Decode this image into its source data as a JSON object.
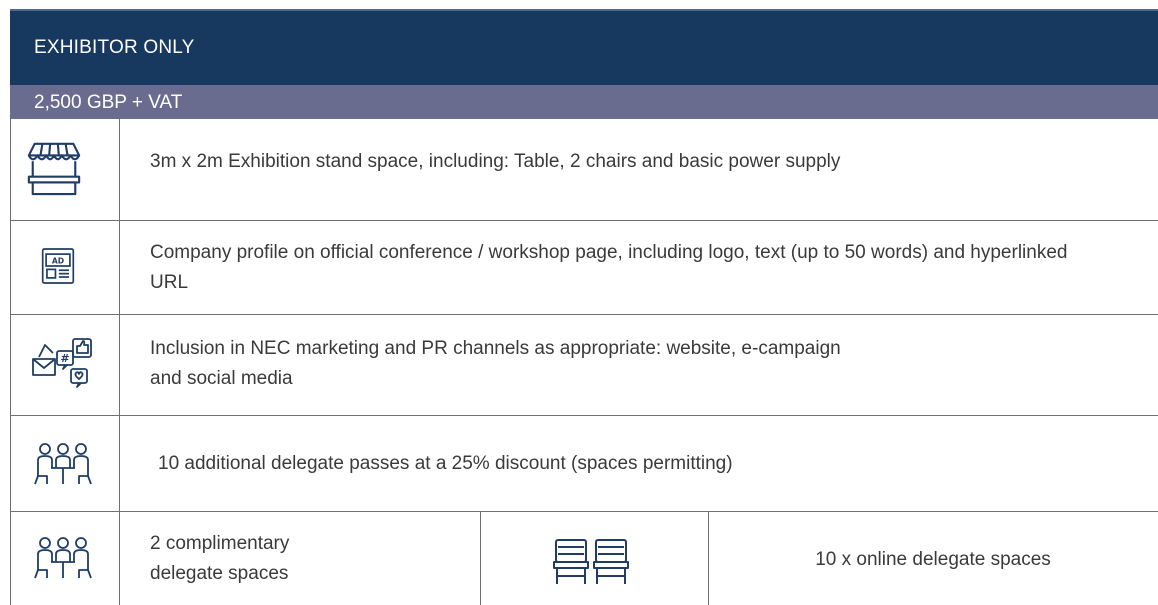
{
  "package": {
    "title": "EXHIBITOR ONLY",
    "price": "2,500 GBP + VAT"
  },
  "benefits": [
    {
      "icon": "market-stall-icon",
      "text": "3m x 2m Exhibition stand space, including: Table, 2 chairs and basic power supply"
    },
    {
      "icon": "ad-newspaper-icon",
      "text": "Company profile on official conference / workshop page, including logo, text (up to 50 words) and hyperlinked URL"
    },
    {
      "icon": "social-media-icon",
      "text": "Inclusion in NEC marketing and PR channels as appropriate: website, e-campaign and social media"
    },
    {
      "icon": "meeting-people-icon",
      "text": "10 additional delegate passes at a 25% discount (spaces permitting)"
    }
  ],
  "bottom_row": {
    "left": {
      "icon": "meeting-people-icon",
      "text": "2 complimentary delegate spaces"
    },
    "right": {
      "icon": "chairs-icon",
      "text": "10 x online delegate spaces"
    }
  },
  "colors": {
    "header_bg": "#17395f",
    "price_bg": "#6a6c8f",
    "icon_stroke": "#1f3d66",
    "border": "#6f6f6f"
  }
}
